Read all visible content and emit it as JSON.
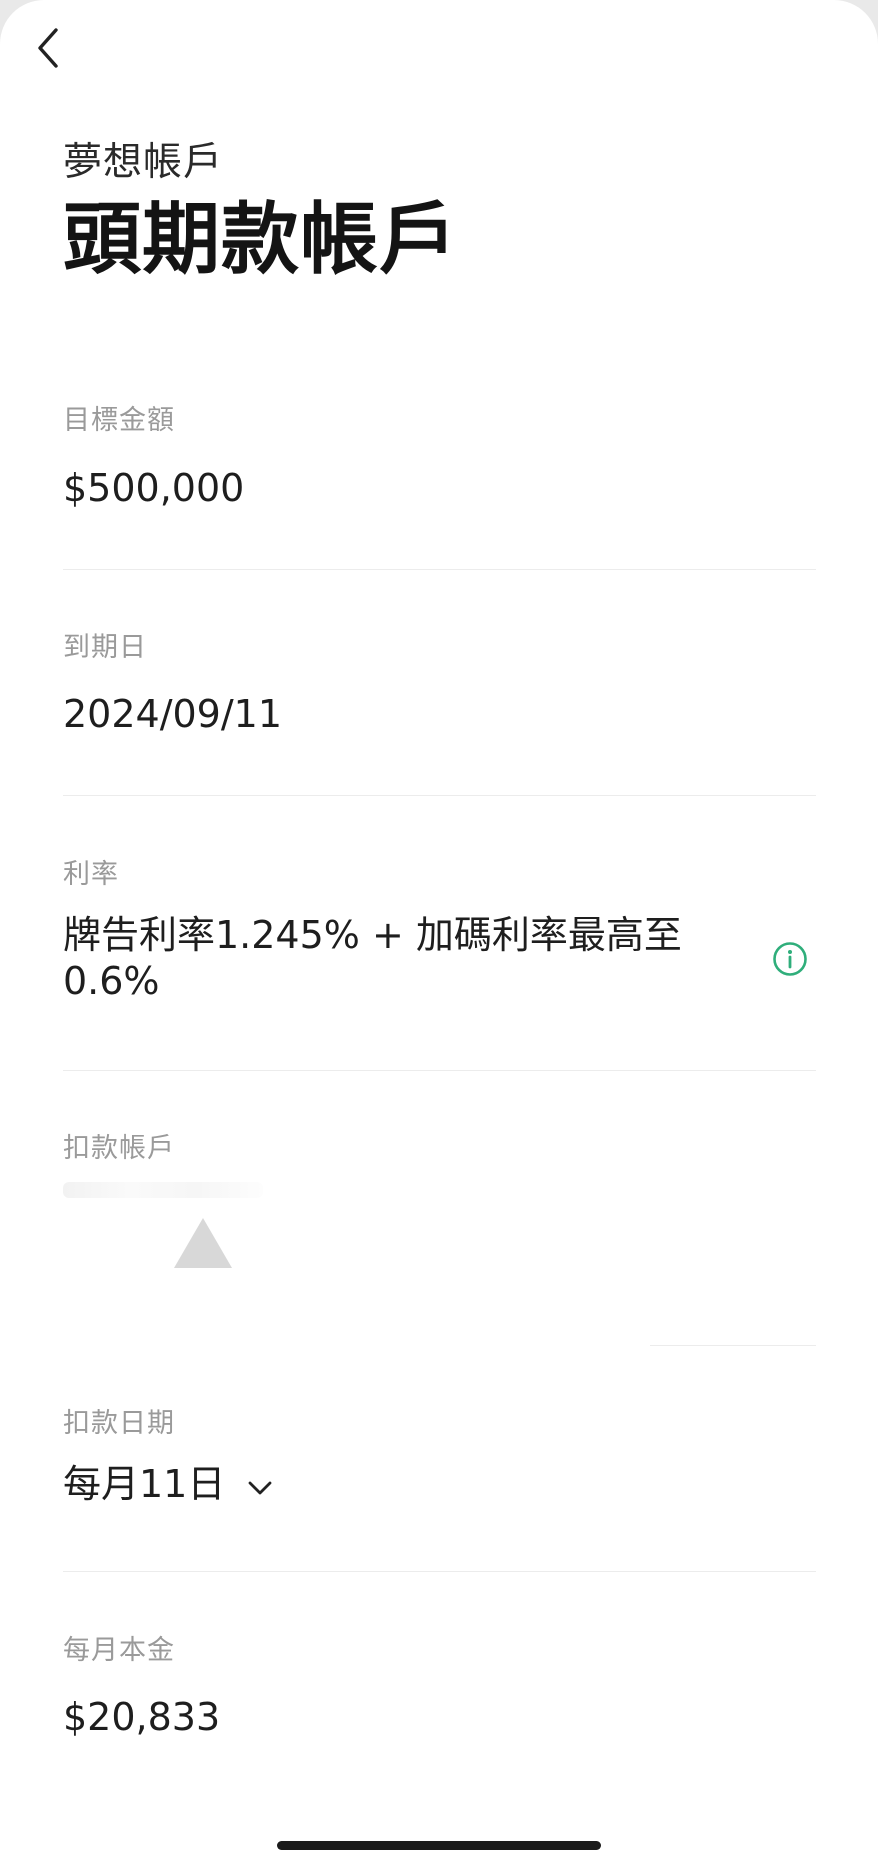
{
  "header": {
    "subtitle": "夢想帳戶",
    "title": "頭期款帳戶"
  },
  "fields": {
    "target_amount": {
      "label": "目標金額",
      "value": "$500,000"
    },
    "due_date": {
      "label": "到期日",
      "value": "2024/09/11"
    },
    "interest_rate": {
      "label": "利率",
      "value": "牌告利率1.245% + 加碼利率最高至0.6%"
    },
    "debit_account": {
      "label": "扣款帳戶"
    },
    "debit_date": {
      "label": "扣款日期",
      "value": "每月11日"
    },
    "monthly_principal": {
      "label": "每月本金",
      "value": "$20,833"
    }
  },
  "icons": {
    "back": "chevron-left-icon",
    "info": "info-circle-icon",
    "dropdown": "chevron-down-icon"
  },
  "colors": {
    "accent": "#2fae7b",
    "label": "#9a9a9a",
    "text": "#1e1e1e",
    "divider": "#ececec"
  }
}
